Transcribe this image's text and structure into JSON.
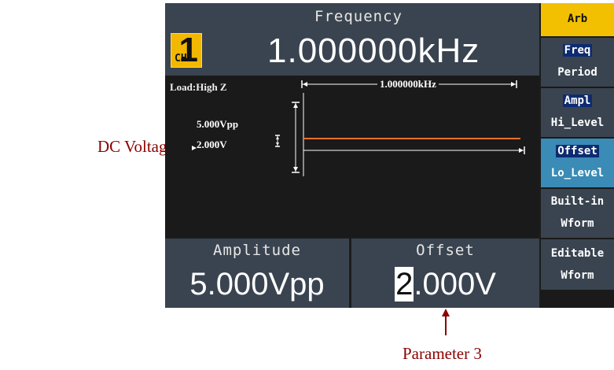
{
  "header": {
    "channel_prefix": "CH",
    "channel_number": "1",
    "parameter_label": "Frequency",
    "parameter_value": "1.000000kHz"
  },
  "plot": {
    "load": "Load:High Z",
    "amplitude_label": "5.000Vpp",
    "dc_voltage_label": "2.000V",
    "frequency_measure": "1.000000kHz",
    "trace_color": "#e8702a"
  },
  "params": {
    "amplitude": {
      "label": "Amplitude",
      "value": "5.000Vpp"
    },
    "offset": {
      "label": "Offset",
      "value_cursor": "2",
      "value_rest": ".000V"
    }
  },
  "menu": {
    "title": "Arb",
    "items": [
      {
        "line1": "Freq",
        "line2": "Period"
      },
      {
        "line1": "Ampl",
        "line2": "Hi_Level"
      },
      {
        "line1": "Offset",
        "line2": "Lo_Level"
      },
      {
        "line1": "Built-in",
        "line2": "Wform"
      },
      {
        "line1": "Editable",
        "line2": "Wform"
      }
    ]
  },
  "annotations": {
    "dc_voltage": "DC Voltage",
    "parameter_3": "Parameter 3"
  },
  "colors": {
    "annotation": "#8b0000",
    "menu_title": "#f2c000",
    "menu_selected": "#3a8bb6",
    "panel": "#3a4450"
  }
}
